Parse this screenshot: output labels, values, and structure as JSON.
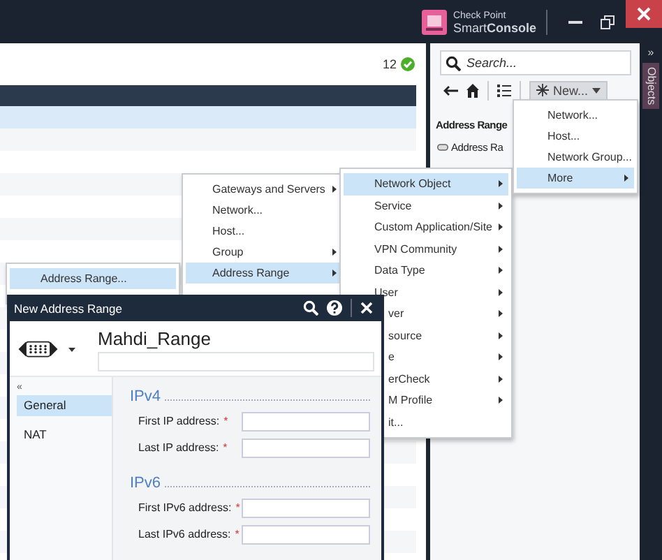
{
  "title_bar": {
    "brand_line1": "Check Point",
    "brand_line2": "Smart**Console**"
  },
  "main": {
    "count": "12"
  },
  "object_explorer": {
    "collapse": "»",
    "side_tab": "Objects",
    "search": {
      "placeholder": "Search..."
    },
    "new_button": {
      "label": "New...",
      "pressed": true
    },
    "section_title": "Address Range",
    "items": [
      {
        "label": "Address Ra"
      }
    ]
  },
  "menus": [
    {
      "items": [
        {
          "label": "Address Range...",
          "selected": true,
          "submenu": false
        }
      ]
    },
    {
      "items": [
        {
          "label": "Gateways and Servers",
          "selected": false,
          "submenu": true
        },
        {
          "label": "Network...",
          "selected": false,
          "submenu": false
        },
        {
          "label": "Host...",
          "selected": false,
          "submenu": false
        },
        {
          "label": "Group",
          "selected": false,
          "submenu": true
        },
        {
          "label": "Address Range",
          "selected": true,
          "submenu": true
        }
      ]
    },
    {
      "items": [
        {
          "label": "Network Object",
          "selected": true,
          "submenu": true,
          "covered": false
        },
        {
          "label": "Service",
          "selected": false,
          "submenu": true,
          "covered": false
        },
        {
          "label": "Custom Application/Site",
          "selected": false,
          "submenu": true,
          "covered": false
        },
        {
          "label": "VPN Community",
          "selected": false,
          "submenu": true,
          "covered": false
        },
        {
          "label": "Data Type",
          "selected": false,
          "submenu": true,
          "covered": false
        },
        {
          "label": "User",
          "selected": false,
          "submenu": true,
          "covered": false
        },
        {
          "label": "ver",
          "selected": false,
          "submenu": true,
          "covered": true
        },
        {
          "label": "source",
          "selected": false,
          "submenu": true,
          "covered": true
        },
        {
          "label": "e",
          "selected": false,
          "submenu": true,
          "covered": true
        },
        {
          "label": "erCheck",
          "selected": false,
          "submenu": true,
          "covered": true
        },
        {
          "label": "M Profile",
          "selected": false,
          "submenu": true,
          "covered": true
        },
        {
          "label": "it...",
          "selected": false,
          "submenu": false,
          "covered": true
        }
      ]
    },
    {
      "items": [
        {
          "label": "Network...",
          "selected": false,
          "submenu": false
        },
        {
          "label": "Host...",
          "selected": false,
          "submenu": false
        },
        {
          "label": "Network Group...",
          "selected": false,
          "submenu": false
        },
        {
          "label": "More",
          "selected": true,
          "submenu": true
        }
      ]
    }
  ],
  "dialog": {
    "title": "New Address Range",
    "name": "Mahdi_Range",
    "collapse": "«",
    "nav": [
      {
        "label": "General",
        "selected": true
      },
      {
        "label": "NAT",
        "selected": false
      }
    ],
    "sections": [
      {
        "title": "IPv4",
        "fields": [
          {
            "label": "First IP address:",
            "mark": "*"
          },
          {
            "label": "Last IP address:",
            "mark": "*"
          }
        ]
      },
      {
        "title": "IPv6",
        "fields": [
          {
            "label": "First IPv6 address:",
            "mark": "*"
          },
          {
            "label": "Last IPv6 address:",
            "mark": "*"
          }
        ]
      }
    ]
  }
}
